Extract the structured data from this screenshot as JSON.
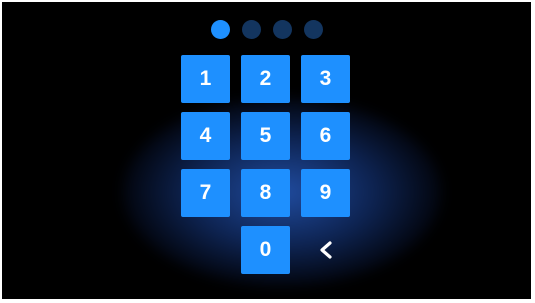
{
  "pin": {
    "total_digits": 4,
    "entered_digits": 1
  },
  "keypad": {
    "keys": [
      "1",
      "2",
      "3",
      "4",
      "5",
      "6",
      "7",
      "8",
      "9"
    ],
    "zero": "0",
    "backspace_icon": "chevron-left-icon"
  },
  "colors": {
    "key": "#1e90ff",
    "dot_filled": "#1e90ff",
    "dot_empty": "#13355f",
    "background": "#000000",
    "glow": "#285fc8"
  }
}
